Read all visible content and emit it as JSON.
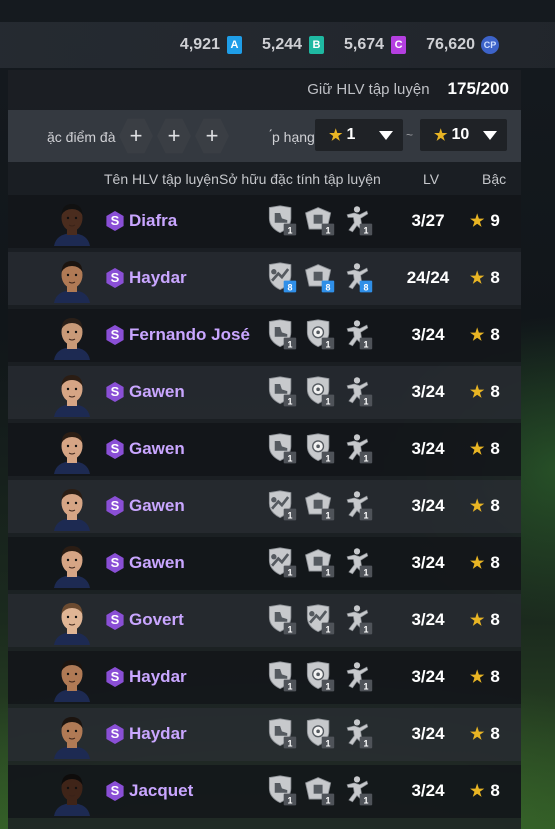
{
  "currencies": [
    {
      "value": "4,921",
      "icon": "a-ticket-icon",
      "letter": "A",
      "color": "#1f9ee8"
    },
    {
      "value": "5,244",
      "icon": "b-ticket-icon",
      "letter": "B",
      "color": "#1fb9a2"
    },
    {
      "value": "5,674",
      "icon": "c-ticket-icon",
      "letter": "C",
      "color": "#b43fe0"
    },
    {
      "value": "76,620",
      "icon": "cp-coin-icon",
      "letter": "CP",
      "color": "#3d63c9"
    }
  ],
  "hold": {
    "label": "Giữ HLV tập luyện",
    "value": "175/200"
  },
  "filter": {
    "traits_label": "ặc điểm đà",
    "add_symbol": "+",
    "rank_label": "́p hạng",
    "rank_from": "1",
    "rank_sep": "~",
    "rank_to": "10"
  },
  "headers": {
    "name": "Tên HLV tập luyện",
    "traits": "Sở hữu đặc tính tập luyện",
    "lv": "LV",
    "tier": "Bậc"
  },
  "accent": {
    "star": "#e9b524",
    "name": "#c9a6ff",
    "badge": "#8a4fd6",
    "boost": "#2f8fe8"
  },
  "coaches": [
    {
      "badge": "S",
      "name": "Diafra",
      "skin": "#4a2c1e",
      "hair": "#111",
      "traits": [
        {
          "icon": "shield-boot-icon",
          "level": "1"
        },
        {
          "icon": "jersey-box-icon",
          "level": "1"
        },
        {
          "icon": "player-run-icon",
          "level": "1"
        }
      ],
      "lv": "3/27",
      "tier": "9"
    },
    {
      "badge": "S",
      "name": "Haydar",
      "skin": "#b07a55",
      "hair": "#1c140f",
      "traits": [
        {
          "icon": "tackle-icon",
          "level": "8"
        },
        {
          "icon": "jersey-box-icon",
          "level": "8"
        },
        {
          "icon": "player-run-icon",
          "level": "8"
        }
      ],
      "lv": "24/24",
      "tier": "8"
    },
    {
      "badge": "S",
      "name": "Fernando José",
      "skin": "#c99a78",
      "hair": "#2a1f18",
      "traits": [
        {
          "icon": "shield-boot-icon",
          "level": "1"
        },
        {
          "icon": "shield-ball-icon",
          "level": "1"
        },
        {
          "icon": "player-run-icon",
          "level": "1"
        }
      ],
      "lv": "3/24",
      "tier": "8"
    },
    {
      "badge": "S",
      "name": "Gawen",
      "skin": "#d6a585",
      "hair": "#2b1d14",
      "traits": [
        {
          "icon": "shield-boot-icon",
          "level": "1"
        },
        {
          "icon": "shield-ball-icon",
          "level": "1"
        },
        {
          "icon": "player-run-icon",
          "level": "1"
        }
      ],
      "lv": "3/24",
      "tier": "8"
    },
    {
      "badge": "S",
      "name": "Gawen",
      "skin": "#d6a585",
      "hair": "#2b1d14",
      "traits": [
        {
          "icon": "shield-boot-icon",
          "level": "1"
        },
        {
          "icon": "shield-ball-icon",
          "level": "1"
        },
        {
          "icon": "player-run-icon",
          "level": "1"
        }
      ],
      "lv": "3/24",
      "tier": "8"
    },
    {
      "badge": "S",
      "name": "Gawen",
      "skin": "#d6a585",
      "hair": "#2b1d14",
      "traits": [
        {
          "icon": "tackle-icon",
          "level": "1"
        },
        {
          "icon": "jersey-box-icon",
          "level": "1"
        },
        {
          "icon": "player-run-icon",
          "level": "1"
        }
      ],
      "lv": "3/24",
      "tier": "8"
    },
    {
      "badge": "S",
      "name": "Gawen",
      "skin": "#d6a585",
      "hair": "#2b1d14",
      "traits": [
        {
          "icon": "tackle-icon",
          "level": "1"
        },
        {
          "icon": "jersey-box-icon",
          "level": "1"
        },
        {
          "icon": "player-run-icon",
          "level": "1"
        }
      ],
      "lv": "3/24",
      "tier": "8"
    },
    {
      "badge": "S",
      "name": "Govert",
      "skin": "#e0b595",
      "hair": "#6b4a30",
      "traits": [
        {
          "icon": "shield-boot-icon",
          "level": "1"
        },
        {
          "icon": "tackle-icon",
          "level": "1"
        },
        {
          "icon": "player-run-icon",
          "level": "1"
        }
      ],
      "lv": "3/24",
      "tier": "8"
    },
    {
      "badge": "S",
      "name": "Haydar",
      "skin": "#b07a55",
      "hair": "#1c140f",
      "traits": [
        {
          "icon": "shield-boot-icon",
          "level": "1"
        },
        {
          "icon": "shield-ball-icon",
          "level": "1"
        },
        {
          "icon": "player-run-icon",
          "level": "1"
        }
      ],
      "lv": "3/24",
      "tier": "8"
    },
    {
      "badge": "S",
      "name": "Haydar",
      "skin": "#b07a55",
      "hair": "#1c140f",
      "traits": [
        {
          "icon": "shield-boot-icon",
          "level": "1"
        },
        {
          "icon": "shield-ball-icon",
          "level": "1"
        },
        {
          "icon": "player-run-icon",
          "level": "1"
        }
      ],
      "lv": "3/24",
      "tier": "8"
    },
    {
      "badge": "S",
      "name": "Jacquet",
      "skin": "#3f2418",
      "hair": "#0e0c0b",
      "traits": [
        {
          "icon": "shield-boot-icon",
          "level": "1"
        },
        {
          "icon": "jersey-box-icon",
          "level": "1"
        },
        {
          "icon": "player-run-icon",
          "level": "1"
        }
      ],
      "lv": "3/24",
      "tier": "8"
    }
  ]
}
